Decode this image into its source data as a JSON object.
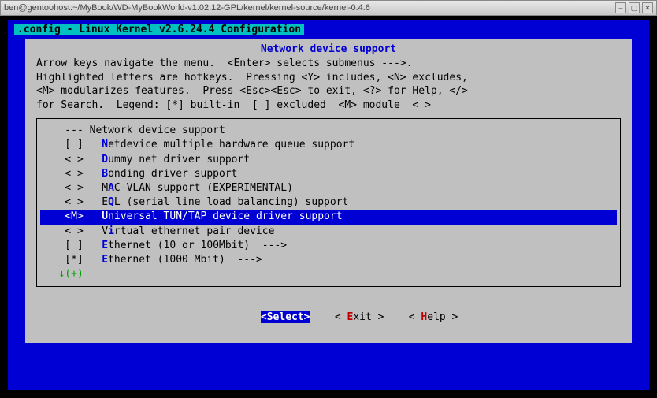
{
  "titlebar": {
    "text": "ben@gentoohost:~/MyBook/WD-MyBookWorld-v1.02.12-GPL/kernel/kernel-source/kernel-0.4.6"
  },
  "config_header": ".config - Linux Kernel v2.6.24.4 Configuration",
  "section_title": "Network device support",
  "help_lines": [
    "Arrow keys navigate the menu.  <Enter> selects submenus --->.",
    "Highlighted letters are hotkeys.  Pressing <Y> includes, <N> excludes,",
    "<M> modularizes features.  Press <Esc><Esc> to exit, <?> for Help, </>",
    "for Search.  Legend: [*] built-in  [ ] excluded  <M> module  < >"
  ],
  "menu": [
    {
      "mark": "---",
      "hot": "",
      "pre": "",
      "label": "Network device support",
      "selected": false,
      "arrow": ""
    },
    {
      "mark": "[ ]",
      "hot": "N",
      "pre": "  ",
      "label": "etdevice multiple hardware queue support",
      "selected": false,
      "arrow": ""
    },
    {
      "mark": "< >",
      "hot": "D",
      "pre": "  ",
      "label": "ummy net driver support",
      "selected": false,
      "arrow": ""
    },
    {
      "mark": "< >",
      "hot": "B",
      "pre": "  ",
      "label": "onding driver support",
      "selected": false,
      "arrow": ""
    },
    {
      "mark": "< >",
      "hot": "A",
      "pre": "  M",
      "label": "C-VLAN support (EXPERIMENTAL)",
      "selected": false,
      "arrow": ""
    },
    {
      "mark": "< >",
      "hot": "Q",
      "pre": "  E",
      "label": "L (serial line load balancing) support",
      "selected": false,
      "arrow": ""
    },
    {
      "mark": "<M>",
      "hot": "U",
      "pre": "  ",
      "label": "niversal TUN/TAP device driver support",
      "selected": true,
      "arrow": ""
    },
    {
      "mark": "< >",
      "hot": "i",
      "pre": "  V",
      "label": "rtual ethernet pair device",
      "selected": false,
      "arrow": ""
    },
    {
      "mark": "[ ]",
      "hot": "E",
      "pre": "  ",
      "label": "thernet (10 or 100Mbit)  --->",
      "selected": false,
      "arrow": ""
    },
    {
      "mark": "[*]",
      "hot": "E",
      "pre": "  ",
      "label": "thernet (1000 Mbit)  --->",
      "selected": false,
      "arrow": ""
    }
  ],
  "more_indicator": "↓(+)",
  "buttons": {
    "select": "<Select>",
    "exit_pre": "< ",
    "exit_hot": "E",
    "exit_post": "xit >",
    "help_pre": "< ",
    "help_hot": "H",
    "help_post": "elp >"
  }
}
